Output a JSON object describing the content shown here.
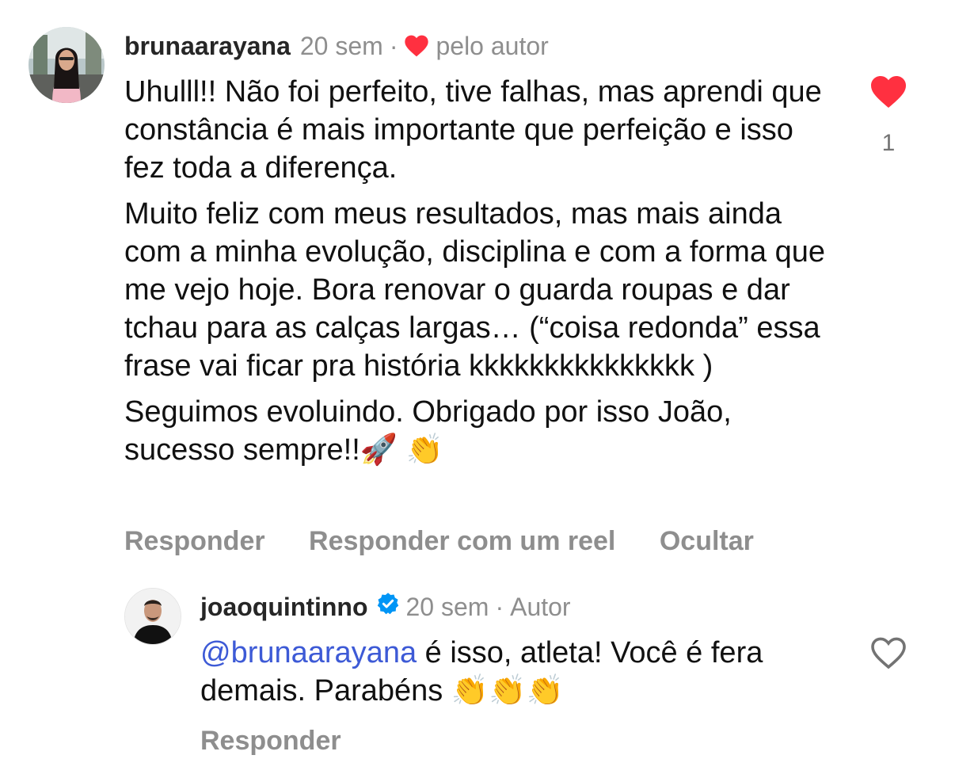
{
  "comment": {
    "username": "brunaarayana",
    "time": "20 sem",
    "separator": "·",
    "author_liked_label": "pelo autor",
    "paragraphs": [
      "Uhulll!! Não foi perfeito, tive falhas, mas aprendi que constância é mais importante que perfeição e isso fez toda a diferença.",
      "Muito feliz com meus resultados, mas mais ainda com a minha evolução, disciplina e com a forma que me vejo hoje. Bora renovar o guarda roupas e dar tchau para as calças largas… (“coisa redonda” essa frase vai ficar pra história kkkkkkkkkkkkkkk )",
      "Seguimos evoluindo. Obrigado por isso João, sucesso sempre!!🚀 👏"
    ],
    "like_count": "1",
    "actions": {
      "reply": "Responder",
      "reply_reel": "Responder com um reel",
      "hide": "Ocultar"
    },
    "heart_color": "#ff3040"
  },
  "reply": {
    "username": "joaoquintinno",
    "time": "20 sem",
    "separator": "·",
    "author_label": "Autor",
    "mention": "@brunaarayana",
    "text": " é isso, atleta! Você é fera demais. Parabéns 👏👏👏",
    "actions": {
      "reply": "Responder"
    },
    "verified_color": "#0095f6"
  }
}
